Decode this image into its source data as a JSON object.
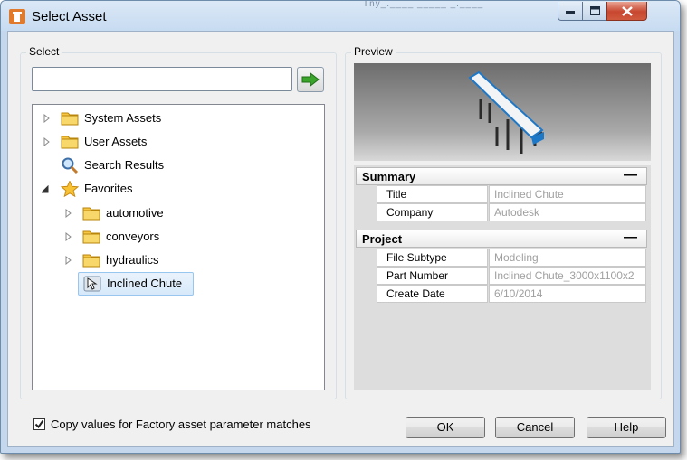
{
  "window": {
    "title": "Select Asset",
    "titlebar_ghost_text": "Tny_.____ _____ _.____"
  },
  "select_group": {
    "label": "Select",
    "search": {
      "value": "",
      "placeholder": ""
    },
    "go_icon": "green-arrow-right-icon",
    "tree": [
      {
        "label": "System Assets",
        "icon": "folder-icon",
        "expandable": true
      },
      {
        "label": "User Assets",
        "icon": "folder-icon",
        "expandable": true
      },
      {
        "label": "Search Results",
        "icon": "magnifier-icon",
        "expandable": false
      },
      {
        "label": "Favorites",
        "icon": "star-icon",
        "expanded": true
      },
      {
        "label": "automotive",
        "icon": "folder-icon",
        "expandable": true
      },
      {
        "label": "conveyors",
        "icon": "folder-icon",
        "expandable": true
      },
      {
        "label": "hydraulics",
        "icon": "folder-icon",
        "expandable": true
      },
      {
        "label": "Inclined Chute",
        "icon": "asset-icon",
        "selected": true
      }
    ]
  },
  "preview_group": {
    "label": "Preview",
    "image_desc_icon": "inclined-chute-thumbnail",
    "sections": [
      {
        "title": "Summary",
        "collapse_symbol": "—",
        "rows": [
          {
            "name": "Title",
            "value": "Inclined Chute"
          },
          {
            "name": "Company",
            "value": "Autodesk"
          }
        ]
      },
      {
        "title": "Project",
        "collapse_symbol": "—",
        "rows": [
          {
            "name": "File Subtype",
            "value": "Modeling"
          },
          {
            "name": "Part Number",
            "value": "Inclined Chute_3000x1100x2"
          },
          {
            "name": "Create Date",
            "value": "6/10/2014"
          }
        ]
      }
    ]
  },
  "footer": {
    "checkbox_label": "Copy values for Factory asset parameter matches",
    "checkbox_checked": true,
    "ok_label": "OK",
    "cancel_label": "Cancel",
    "help_label": "Help"
  },
  "colors": {
    "accent_blue": "#1e78c8",
    "folder_yellow": "#f6c744",
    "go_green": "#3aa52a"
  }
}
